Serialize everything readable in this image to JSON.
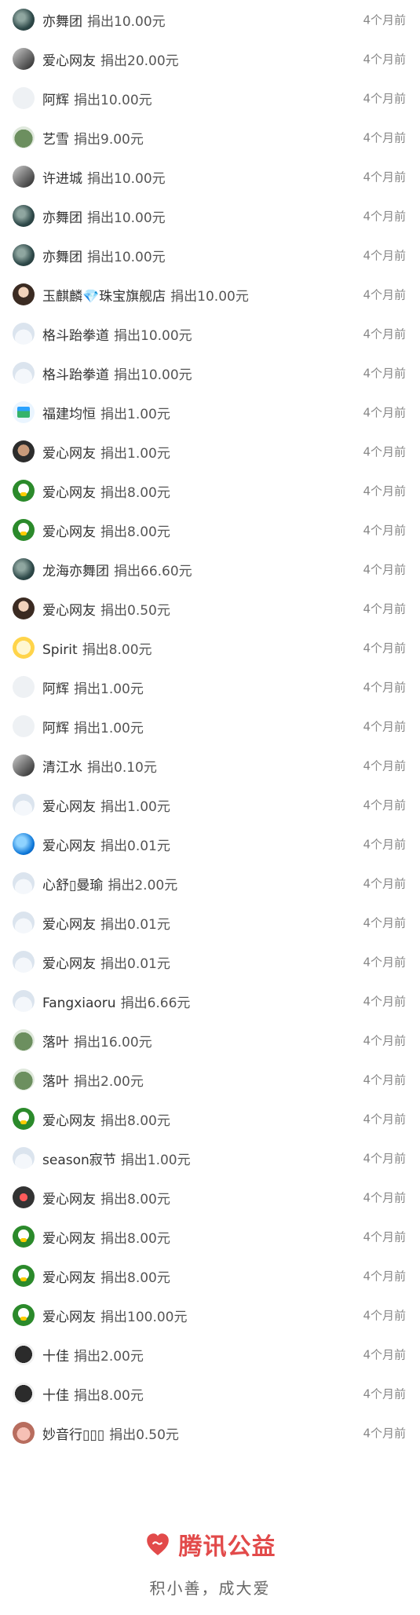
{
  "rows": [
    {
      "avatar": "dark",
      "name": "亦舞团",
      "donation": "捐出10.00元",
      "time": "4个月前"
    },
    {
      "avatar": "grayscape",
      "name": "爱心网友",
      "donation": "捐出20.00元",
      "time": "4个月前"
    },
    {
      "avatar": "blank",
      "name": "阿辉",
      "donation": "捐出10.00元",
      "time": "4个月前"
    },
    {
      "avatar": "frog",
      "name": "艺雪",
      "donation": "捐出9.00元",
      "time": "4个月前"
    },
    {
      "avatar": "grayscape",
      "name": "许进城",
      "donation": "捐出10.00元",
      "time": "4个月前"
    },
    {
      "avatar": "dark",
      "name": "亦舞团",
      "donation": "捐出10.00元",
      "time": "4个月前"
    },
    {
      "avatar": "dark",
      "name": "亦舞团",
      "donation": "捐出10.00元",
      "time": "4个月前"
    },
    {
      "avatar": "portrait",
      "name": "玉麒麟💎珠宝旗舰店",
      "donation": "捐出10.00元",
      "time": "4个月前"
    },
    {
      "avatar": "cloud",
      "name": "格斗跆拳道",
      "donation": "捐出10.00元",
      "time": "4个月前"
    },
    {
      "avatar": "cloud",
      "name": "格斗跆拳道",
      "donation": "捐出10.00元",
      "time": "4个月前"
    },
    {
      "avatar": "smallbadge",
      "name": "福建均恒",
      "donation": "捐出1.00元",
      "time": "4个月前"
    },
    {
      "avatar": "man",
      "name": "爱心网友",
      "donation": "捐出1.00元",
      "time": "4个月前"
    },
    {
      "avatar": "qq",
      "name": "爱心网友",
      "donation": "捐出8.00元",
      "time": "4个月前"
    },
    {
      "avatar": "qq",
      "name": "爱心网友",
      "donation": "捐出8.00元",
      "time": "4个月前"
    },
    {
      "avatar": "dark",
      "name": "龙海亦舞团",
      "donation": "捐出66.60元",
      "time": "4个月前"
    },
    {
      "avatar": "portrait",
      "name": "爱心网友",
      "donation": "捐出0.50元",
      "time": "4个月前"
    },
    {
      "avatar": "yellow",
      "name": "Spirit",
      "donation": "捐出8.00元",
      "time": "4个月前"
    },
    {
      "avatar": "blank",
      "name": "阿辉",
      "donation": "捐出1.00元",
      "time": "4个月前"
    },
    {
      "avatar": "blank",
      "name": "阿辉",
      "donation": "捐出1.00元",
      "time": "4个月前"
    },
    {
      "avatar": "grayscape",
      "name": "清江水",
      "donation": "捐出0.10元",
      "time": "4个月前"
    },
    {
      "avatar": "cloud",
      "name": "爱心网友",
      "donation": "捐出1.00元",
      "time": "4个月前"
    },
    {
      "avatar": "blue",
      "name": "爱心网友",
      "donation": "捐出0.01元",
      "time": "4个月前"
    },
    {
      "avatar": "cloud",
      "name": "心舒▯曼瑜",
      "donation": "捐出2.00元",
      "time": "4个月前"
    },
    {
      "avatar": "cloud",
      "name": "爱心网友",
      "donation": "捐出0.01元",
      "time": "4个月前"
    },
    {
      "avatar": "cloud",
      "name": "爱心网友",
      "donation": "捐出0.01元",
      "time": "4个月前"
    },
    {
      "avatar": "cloud",
      "name": "Fangxiaoru",
      "donation": "捐出6.66元",
      "time": "4个月前"
    },
    {
      "avatar": "frog",
      "name": "落叶",
      "donation": "捐出16.00元",
      "time": "4个月前"
    },
    {
      "avatar": "frog",
      "name": "落叶",
      "donation": "捐出2.00元",
      "time": "4个月前"
    },
    {
      "avatar": "qq",
      "name": "爱心网友",
      "donation": "捐出8.00元",
      "time": "4个月前"
    },
    {
      "avatar": "cloud",
      "name": "season寂节",
      "donation": "捐出1.00元",
      "time": "4个月前"
    },
    {
      "avatar": "redcar",
      "name": "爱心网友",
      "donation": "捐出8.00元",
      "time": "4个月前"
    },
    {
      "avatar": "qq",
      "name": "爱心网友",
      "donation": "捐出8.00元",
      "time": "4个月前"
    },
    {
      "avatar": "qq",
      "name": "爱心网友",
      "donation": "捐出8.00元",
      "time": "4个月前"
    },
    {
      "avatar": "qq",
      "name": "爱心网友",
      "donation": "捐出100.00元",
      "time": "4个月前"
    },
    {
      "avatar": "logoish",
      "name": "十佳",
      "donation": "捐出2.00元",
      "time": "4个月前"
    },
    {
      "avatar": "logoish",
      "name": "十佳",
      "donation": "捐出8.00元",
      "time": "4个月前"
    },
    {
      "avatar": "pinkface",
      "name": "妙音行▯▯▯",
      "donation": "捐出0.50元",
      "time": "4个月前"
    }
  ],
  "footer": {
    "brand": "腾讯公益",
    "slogan": "积小善，成大爱"
  },
  "colors": {
    "brand_red": "#e24a4a"
  },
  "icons": {
    "brand": "heart-hand-icon"
  }
}
